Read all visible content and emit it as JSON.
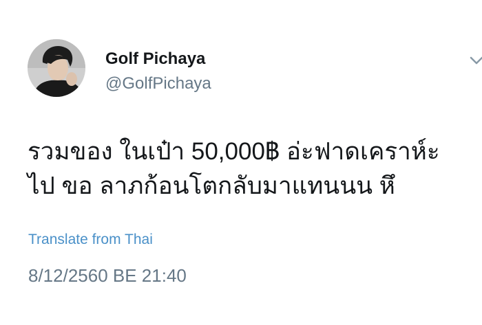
{
  "tweet": {
    "author": {
      "display_name": "Golf Pichaya",
      "handle": "@GolfPichaya"
    },
    "text_lines": [
      "รวมของ ในเป๋า 50,000฿ อ่ะฟาดเคราห์ะ",
      "ไป ขอ ลาภก้อนโตกลับมาแทนนน หึ"
    ],
    "translate_link": "Translate from Thai",
    "timestamp": "8/12/2560 BE 21:40"
  },
  "icons": {
    "menu": "chevron-down-icon",
    "avatar": "profile-photo"
  },
  "colors": {
    "primary_text": "#14171a",
    "secondary_text": "#657786",
    "link": "#4a90c8",
    "background": "#ffffff"
  }
}
